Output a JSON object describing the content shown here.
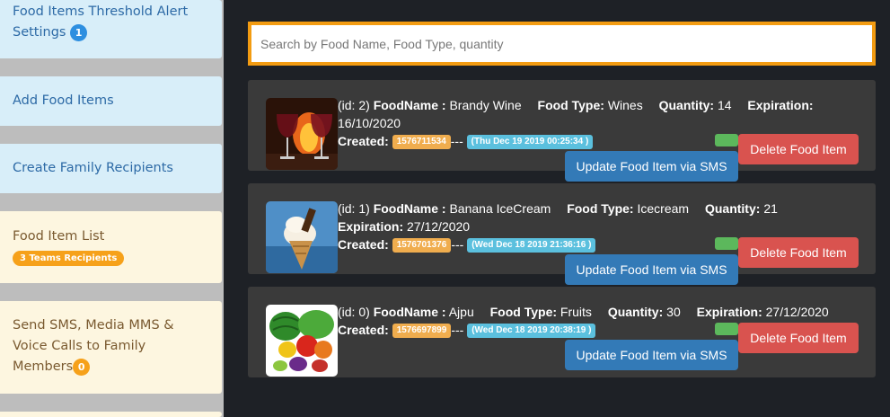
{
  "sidebar": {
    "items": [
      {
        "label": "Food Items Threshold Alert Settings",
        "badge": "1"
      },
      {
        "label": "Add Food Items"
      },
      {
        "label": "Create Family Recipients"
      },
      {
        "label": "Food Item List",
        "badge": "3 Teams Recipients"
      },
      {
        "label": "Send SMS, Media MMS & Voice Calls to Family Members",
        "badge": "0"
      }
    ]
  },
  "search": {
    "placeholder": "Search by Food Name, Food Type, quantity"
  },
  "labels": {
    "foodname": "FoodName :",
    "foodtype": "Food Type:",
    "quantity": "Quantity:",
    "expiration": "Expiration:",
    "created": "Created:",
    "dash": "---",
    "delete_btn": "Delete Food Item",
    "update_btn": "Update Food Item via SMS"
  },
  "food_items": [
    {
      "id_text": "(id: 2)",
      "name": "Brandy Wine",
      "type": "Wines",
      "quantity": "14",
      "expiration": "16/10/2020",
      "created_ts": "1576711534",
      "created_date": "(Thu Dec 19 2019 00:25:34 )",
      "image": "wine-glasses-fire"
    },
    {
      "id_text": "(id: 1)",
      "name": "Banana IceCream",
      "type": "Icecream",
      "quantity": "21",
      "expiration": "27/12/2020",
      "created_ts": "1576701376",
      "created_date": "(Wed Dec 18 2019 21:36:16 )",
      "image": "ice-cream-cone"
    },
    {
      "id_text": "(id: 0)",
      "name": "Ajpu",
      "type": "Fruits",
      "quantity": "30",
      "expiration": "27/12/2020",
      "created_ts": "1576697899",
      "created_date": "(Wed Dec 18 2019 20:38:19 )",
      "image": "fruits-vegetables"
    }
  ],
  "colors": {
    "accent": "#f39c12",
    "danger": "#d9534f",
    "primary": "#337ab7",
    "success": "#5cb85c",
    "info": "#5bc0de",
    "warning": "#f0ad4e"
  }
}
